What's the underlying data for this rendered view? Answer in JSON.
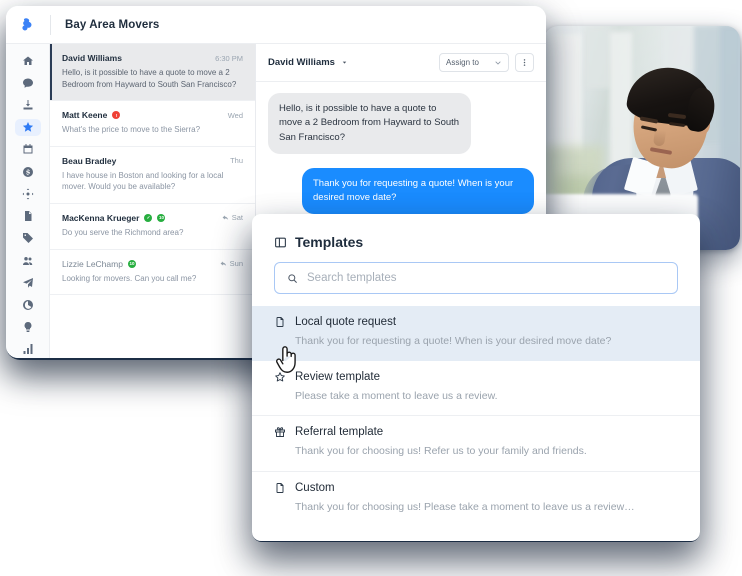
{
  "app": {
    "logo_icon": "brand-logo-icon",
    "title": "Bay Area Movers"
  },
  "sidebar": {
    "items": [
      {
        "icon": "home-icon",
        "name": "home",
        "active": false
      },
      {
        "icon": "chat-bubble-icon",
        "name": "messages",
        "active": false
      },
      {
        "icon": "inbox-download-icon",
        "name": "inbox",
        "active": false
      },
      {
        "icon": "star-icon",
        "name": "favorites",
        "active": true
      },
      {
        "icon": "calendar-icon",
        "name": "calendar",
        "active": false
      },
      {
        "icon": "dollar-circle-icon",
        "name": "billing",
        "active": false
      },
      {
        "icon": "network-nodes-icon",
        "name": "automations",
        "active": false
      },
      {
        "icon": "document-icon",
        "name": "documents",
        "active": false
      },
      {
        "icon": "tag-icon",
        "name": "tags",
        "active": false
      },
      {
        "icon": "people-icon",
        "name": "contacts",
        "active": false
      },
      {
        "icon": "paper-plane-icon",
        "name": "campaigns",
        "active": false
      },
      {
        "icon": "pie-chart-icon",
        "name": "insights",
        "active": false
      },
      {
        "icon": "lightbulb-icon",
        "name": "ideas",
        "active": false
      },
      {
        "icon": "bar-chart-icon",
        "name": "reports",
        "active": false
      }
    ]
  },
  "conversations": [
    {
      "name": "David Williams",
      "time": "6:30 PM",
      "preview": "Hello, is it possible to have a quote to move a 2 Bedroom from Hayward to South San Francisco?",
      "selected": true,
      "badges": [],
      "replied": false,
      "muted": false
    },
    {
      "name": "Matt Keene",
      "time": "Wed",
      "preview": "What's the price to move to the Sierra?",
      "selected": false,
      "badges": [
        {
          "color": "red",
          "label": "!"
        }
      ],
      "replied": false,
      "muted": false
    },
    {
      "name": "Beau Bradley",
      "time": "Thu",
      "preview": "I have house in Boston and looking for a local mover. Would you be available?",
      "selected": false,
      "badges": [],
      "replied": false,
      "muted": false
    },
    {
      "name": "MacKenna Krueger",
      "time": "Sat",
      "preview": "Do you serve the Richmond area?",
      "selected": false,
      "badges": [
        {
          "color": "green",
          "label": "✓"
        },
        {
          "color": "green",
          "label": "10"
        }
      ],
      "replied": true,
      "muted": false
    },
    {
      "name": "Lizzie LeChamp",
      "time": "Sun",
      "preview": "Looking for movers. Can you call me?",
      "selected": false,
      "badges": [
        {
          "color": "green",
          "label": "10"
        }
      ],
      "replied": true,
      "muted": true
    }
  ],
  "chat": {
    "title": "David Williams",
    "caret_icon": "caret-down-icon",
    "assign_label": "Assign to",
    "assign_caret_icon": "chevron-down-icon",
    "more_icon": "kebab-menu-icon",
    "messages": [
      {
        "direction": "in",
        "text": "Hello, is it possible to have a quote to move a 2 Bedroom from Hayward to South San Francisco?"
      },
      {
        "direction": "out",
        "text": "Thank you for requesting a quote! When is your desired move date?"
      }
    ]
  },
  "templates_panel": {
    "header_icon": "templates-panel-icon",
    "title": "Templates",
    "search": {
      "icon": "search-icon",
      "value": "",
      "placeholder": "Search templates"
    },
    "items": [
      {
        "icon": "document-icon",
        "name": "Local quote request",
        "description": "Thank you for requesting a quote! When is your desired move date?",
        "hovered": true
      },
      {
        "icon": "star-outline-icon",
        "name": "Review template",
        "description": "Please take a moment to leave us a review.",
        "hovered": false
      },
      {
        "icon": "gift-icon",
        "name": "Referral template",
        "description": "Thank you for choosing us! Refer us to your family and friends.",
        "hovered": false
      },
      {
        "icon": "document-icon",
        "name": "Custom",
        "description": "Thank you for choosing us! Please take a moment to leave us a review…",
        "hovered": false
      }
    ]
  },
  "photo": {
    "alt": "man-in-blue-suit-looking-down"
  },
  "colors": {
    "accent_blue": "#1a8cff",
    "brand_blue": "#3b82f6",
    "badge_red": "#ef4136",
    "badge_green": "#27ae3f",
    "dark_frame": "#22354e"
  }
}
